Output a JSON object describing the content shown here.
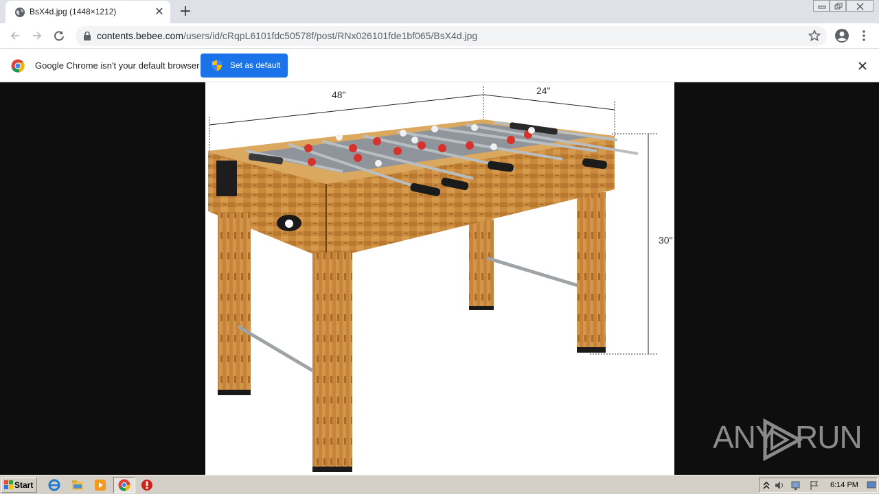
{
  "browser": {
    "tab": {
      "title": "BsX4d.jpg (1448×1212)",
      "favicon": "globe-icon",
      "close_icon": "close-icon"
    },
    "new_tab_label": "+",
    "url": {
      "host": "contents.bebee.com",
      "path": "/users/id/cRqpL6101fdc50578f/post/RNx026101fde1bf065/BsX4d.jpg"
    },
    "infobar": {
      "message": "Google Chrome isn't your default browser",
      "button_label": "Set as default"
    }
  },
  "image": {
    "dimension_labels": {
      "width": "48\"",
      "depth": "24\"",
      "height": "30\""
    }
  },
  "watermark": {
    "text_left": "ANY",
    "text_right": "RUN"
  },
  "taskbar": {
    "start_label": "Start",
    "clock": "6:14 PM",
    "pinned": [
      "ie-icon",
      "explorer-icon",
      "media-player-icon",
      "chrome-icon",
      "stop-icon"
    ]
  },
  "colors": {
    "accent": "#1a73e8",
    "tabstrip": "#dee1e6",
    "taskbar": "#d4d0c8",
    "wood": "#c98a3e"
  }
}
